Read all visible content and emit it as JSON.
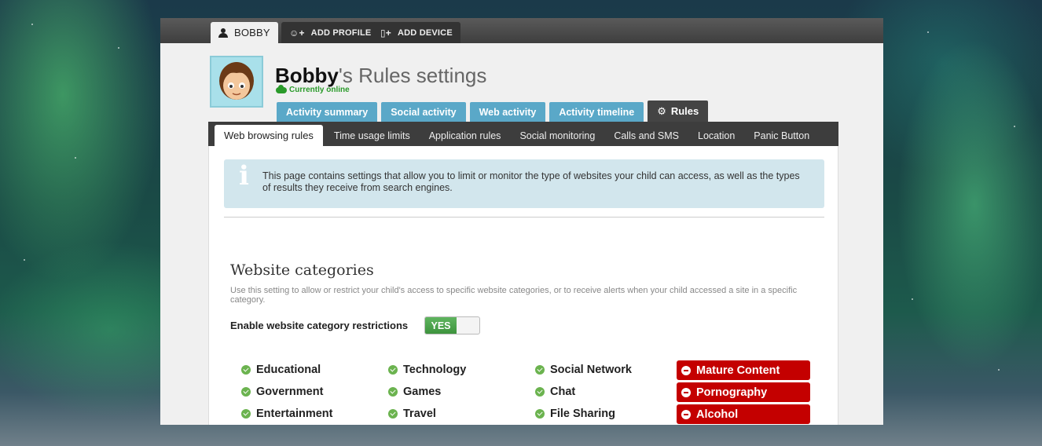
{
  "topbar": {
    "tabs": [
      {
        "label": "BOBBY",
        "icon": "user-icon"
      },
      {
        "label": "ADD PROFILE",
        "icon": "add-user-icon"
      },
      {
        "label": "ADD DEVICE",
        "icon": "add-device-icon"
      }
    ]
  },
  "profile": {
    "name": "Bobby",
    "title_suffix": "'s Rules settings",
    "status": "Currently online"
  },
  "main_tabs": [
    {
      "label": "Activity summary"
    },
    {
      "label": "Social activity"
    },
    {
      "label": "Web activity"
    },
    {
      "label": "Activity timeline"
    },
    {
      "label": "Rules",
      "active": true
    }
  ],
  "sub_tabs": [
    {
      "label": "Web browsing rules",
      "active": true
    },
    {
      "label": "Time usage limits"
    },
    {
      "label": "Application rules"
    },
    {
      "label": "Social monitoring"
    },
    {
      "label": "Calls and SMS"
    },
    {
      "label": "Location"
    },
    {
      "label": "Panic Button"
    }
  ],
  "info": {
    "icon": "i",
    "text": "This page contains settings that allow you to limit or monitor the type of websites your child can access, as well as the types of results they receive from search engines."
  },
  "section": {
    "title": "Website categories",
    "description": "Use this setting to allow or restrict your child's access to specific website categories, or to receive alerts when your child accessed a site in a specific category.",
    "enable_label": "Enable website category restrictions",
    "toggle_label": "YES"
  },
  "categories": {
    "col1": [
      "Educational",
      "Government",
      "Entertainment"
    ],
    "col2": [
      "Technology",
      "Games",
      "Travel"
    ],
    "col3": [
      "Social Network",
      "Chat",
      "File Sharing"
    ],
    "blocked": [
      "Mature Content",
      "Pornography",
      "Alcohol"
    ]
  },
  "colors": {
    "allowed": "#6bb34f",
    "blocked": "#c40000",
    "tab": "#5aa8c8",
    "info_bg": "#d2e6ed"
  }
}
